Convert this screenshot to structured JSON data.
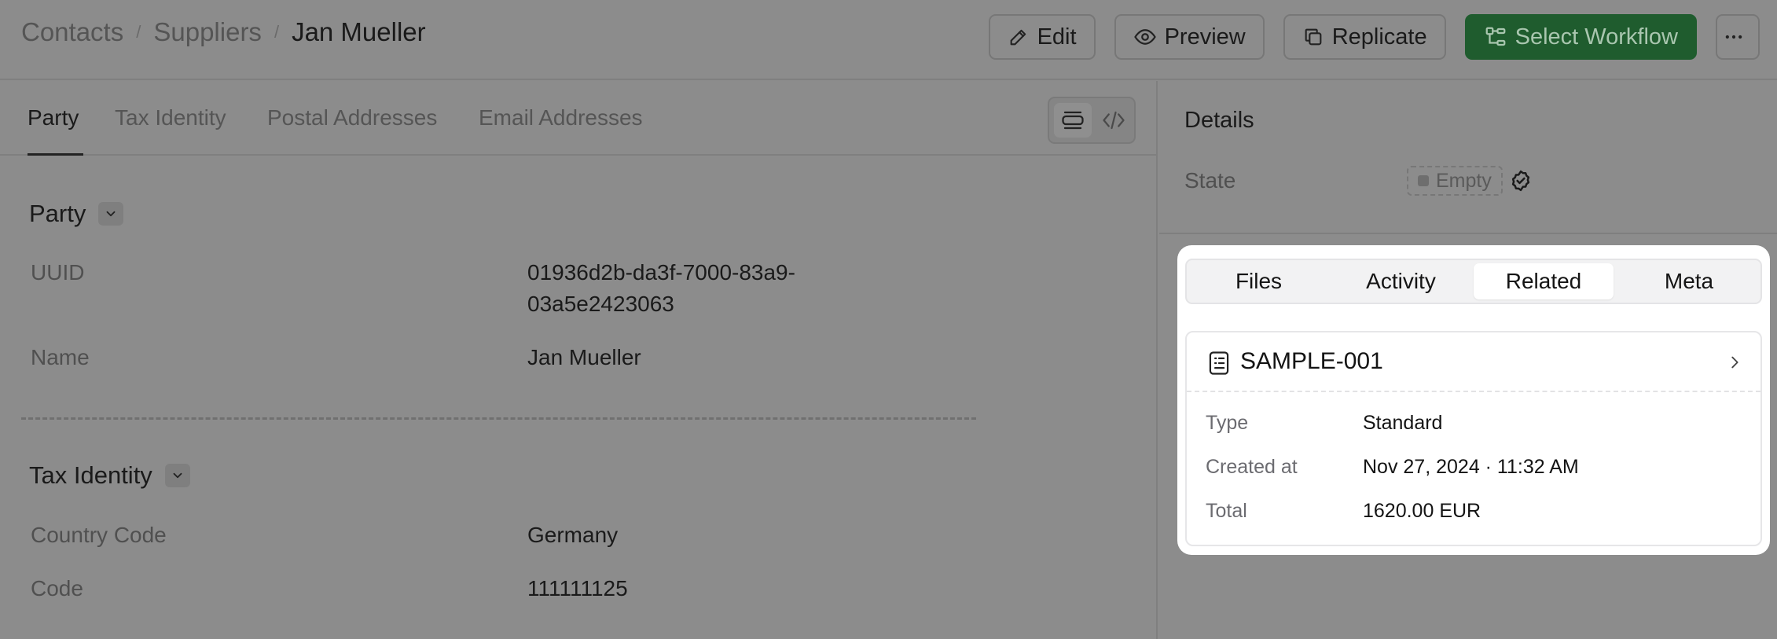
{
  "breadcrumb": {
    "items": [
      "Contacts",
      "Suppliers"
    ],
    "separator": "/",
    "current": "Jan Mueller"
  },
  "toolbar": {
    "edit_label": "Edit",
    "preview_label": "Preview",
    "replicate_label": "Replicate",
    "workflow_label": "Select Workflow",
    "more_icon": "more-horizontal-icon"
  },
  "tabs": [
    {
      "label": "Party",
      "active": true
    },
    {
      "label": "Tax Identity",
      "active": false
    },
    {
      "label": "Postal Addresses",
      "active": false
    },
    {
      "label": "Email Addresses",
      "active": false
    }
  ],
  "party": {
    "title": "Party",
    "uuid_label": "UUID",
    "uuid_line1": "01936d2b-da3f-7000-83a9-",
    "uuid_line2": "03a5e2423063",
    "name_label": "Name",
    "name_value": "Jan Mueller"
  },
  "tax": {
    "title": "Tax Identity",
    "country_label": "Country Code",
    "country_value": "Germany",
    "code_label": "Code",
    "code_value": "111111125"
  },
  "details": {
    "title": "Details",
    "state_label": "State",
    "state_value": "Empty"
  },
  "panel": {
    "tabs": [
      {
        "label": "Files",
        "active": false
      },
      {
        "label": "Activity",
        "active": false
      },
      {
        "label": "Related",
        "active": true
      },
      {
        "label": "Meta",
        "active": false
      }
    ],
    "related": {
      "title": "SAMPLE-001",
      "type_label": "Type",
      "type_value": "Standard",
      "created_label": "Created at",
      "created_value": "Nov 27, 2024 · 11:32 AM",
      "total_label": "Total",
      "total_value": "1620.00 EUR"
    }
  },
  "colors": {
    "primary": "#1f5c2e",
    "overlay": "#8c8c8c",
    "card": "#ffffff"
  }
}
